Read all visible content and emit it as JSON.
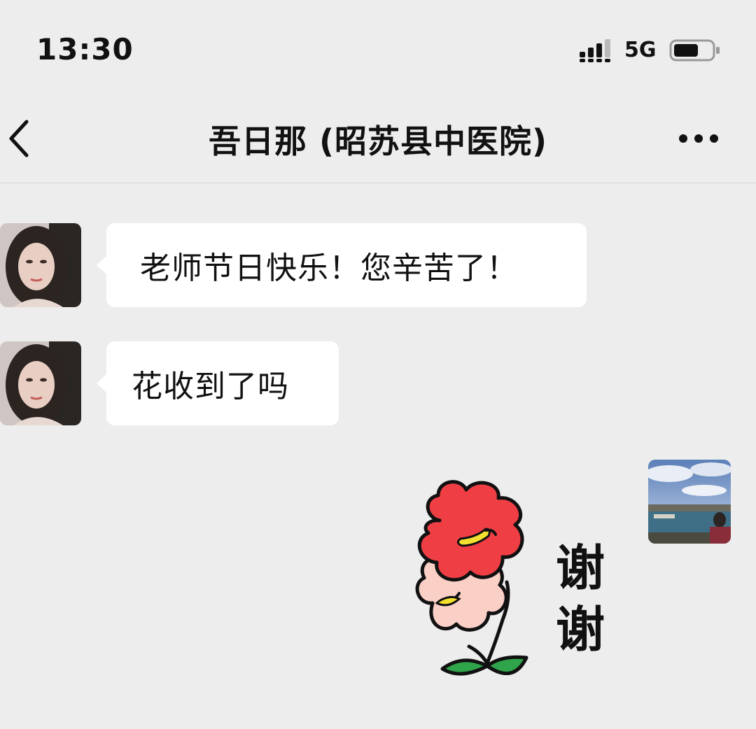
{
  "status_bar": {
    "time": "13:30",
    "network": "5G",
    "icons": [
      "signal-icon",
      "battery-icon"
    ]
  },
  "nav": {
    "back_icon": "chevron-left-icon",
    "title": "吾日那 (昭苏县中医院)",
    "more_icon": "more-dots-icon"
  },
  "messages": [
    {
      "sender": "contact",
      "type": "text",
      "text": "老师节日快乐！您辛苦了！"
    },
    {
      "sender": "contact",
      "type": "text",
      "text": "花收到了吗"
    },
    {
      "sender": "self",
      "type": "sticker",
      "sticker": "flower-thanks-sticker",
      "caption": "谢谢"
    }
  ],
  "colors": {
    "background": "#ededed",
    "bubble": "#ffffff",
    "flower_red": "#ef3e44",
    "flower_pink": "#f9cfc6",
    "leaf_green": "#2fa44a"
  }
}
